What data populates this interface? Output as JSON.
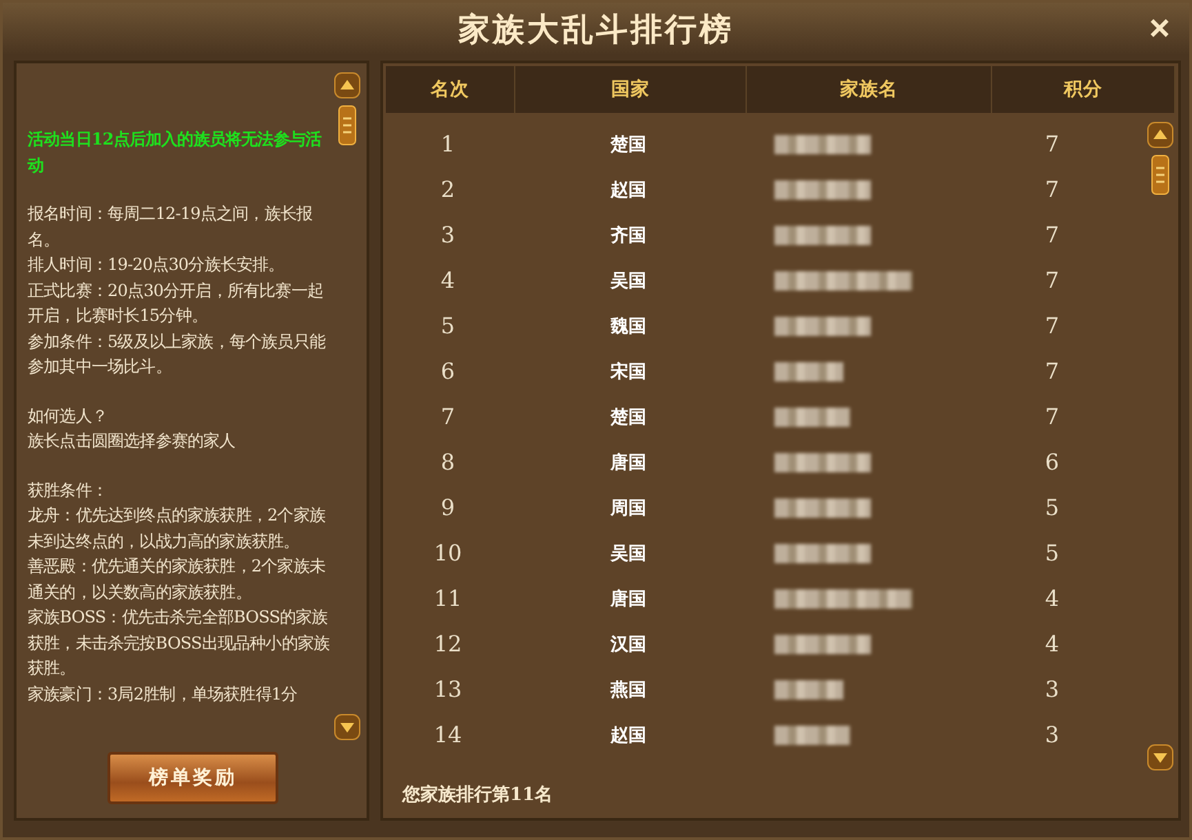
{
  "window": {
    "title": "家族大乱斗排行榜",
    "close": "×"
  },
  "rules": {
    "sections": [
      [
        {
          "kind": "notice",
          "text": "活动当日12点后加入的族员将无法参与活动"
        }
      ],
      [
        {
          "kind": "normal",
          "text": "报名时间：每周二12-19点之间，族长报名。"
        },
        {
          "kind": "normal",
          "text": "排人时间：19-20点30分族长安排。"
        },
        {
          "kind": "normal",
          "text": "正式比赛：20点30分开启，所有比赛一起开启，比赛时长15分钟。"
        },
        {
          "kind": "normal",
          "text": "参加条件：5级及以上家族，每个族员只能参加其中一场比斗。"
        }
      ],
      [
        {
          "kind": "normal",
          "text": "如何选人？"
        },
        {
          "kind": "normal",
          "text": "族长点击圆圈选择参赛的家人"
        }
      ],
      [
        {
          "kind": "normal",
          "text": "获胜条件："
        },
        {
          "kind": "normal",
          "text": "龙舟：优先达到终点的家族获胜，2个家族未到达终点的，以战力高的家族获胜。"
        },
        {
          "kind": "normal",
          "text": "善恶殿：优先通关的家族获胜，2个家族未通关的，以关数高的家族获胜。"
        },
        {
          "kind": "normal",
          "text": "家族BOSS：优先击杀完全部BOSS的家族获胜，未击杀完按BOSS出现品种小的家族获胜。"
        },
        {
          "kind": "normal",
          "text": "家族豪门：3局2胜制，单场获胜得1分"
        }
      ]
    ],
    "button": "榜单奖励"
  },
  "table": {
    "columns": [
      "名次",
      "国家",
      "家族名",
      "积分"
    ],
    "rows": [
      {
        "rank": "1",
        "country": "楚国",
        "score": "7"
      },
      {
        "rank": "2",
        "country": "赵国",
        "score": "7"
      },
      {
        "rank": "3",
        "country": "齐国",
        "score": "7"
      },
      {
        "rank": "4",
        "country": "吴国",
        "score": "7"
      },
      {
        "rank": "5",
        "country": "魏国",
        "score": "7"
      },
      {
        "rank": "6",
        "country": "宋国",
        "score": "7"
      },
      {
        "rank": "7",
        "country": "楚国",
        "score": "7"
      },
      {
        "rank": "8",
        "country": "唐国",
        "score": "6"
      },
      {
        "rank": "9",
        "country": "周国",
        "score": "5"
      },
      {
        "rank": "10",
        "country": "吴国",
        "score": "5"
      },
      {
        "rank": "11",
        "country": "唐国",
        "score": "4"
      },
      {
        "rank": "12",
        "country": "汉国",
        "score": "4"
      },
      {
        "rank": "13",
        "country": "燕国",
        "score": "3"
      },
      {
        "rank": "14",
        "country": "赵国",
        "score": "3"
      }
    ],
    "footer": "您家族排行第11名"
  }
}
